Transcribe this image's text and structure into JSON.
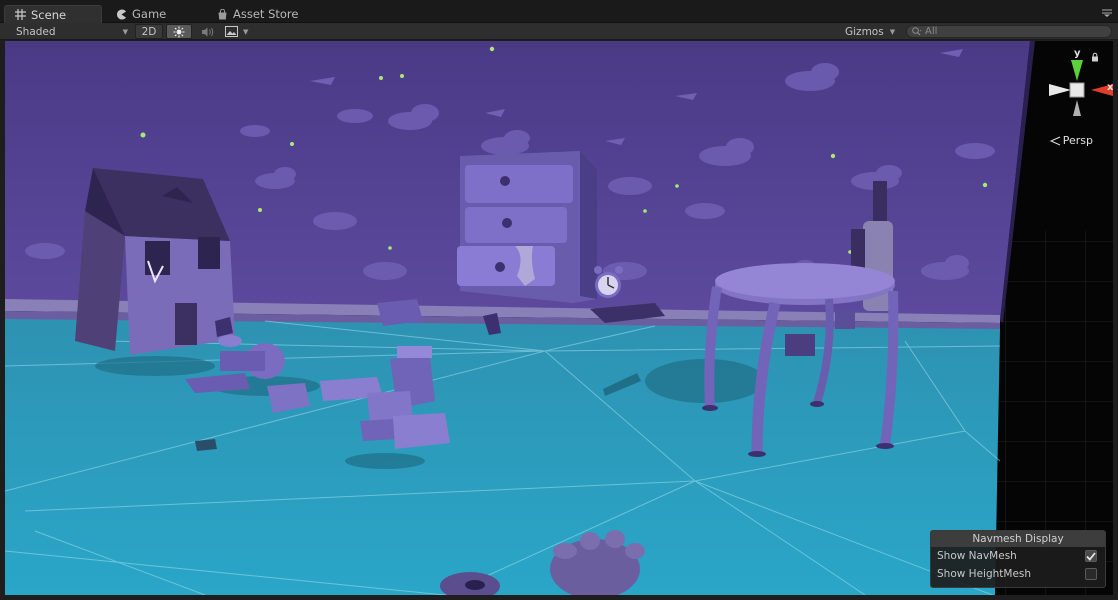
{
  "tabs": [
    {
      "label": "Scene",
      "icon": "scene-grid-icon",
      "active": true
    },
    {
      "label": "Game",
      "icon": "game-pacman-icon",
      "active": false
    },
    {
      "label": "Asset Store",
      "icon": "store-bag-icon",
      "active": false
    }
  ],
  "toolbar": {
    "shading_mode": "Shaded",
    "mode_2d_label": "2D",
    "gizmos_label": "Gizmos",
    "search_placeholder": "All"
  },
  "gizmo": {
    "axis_y": "y",
    "axis_x": "x",
    "projection_label": "Persp"
  },
  "navmesh_panel": {
    "title": "Navmesh Display",
    "options": [
      {
        "label": "Show NavMesh",
        "checked": true
      },
      {
        "label": "Show HeightMesh",
        "checked": false
      }
    ]
  },
  "colors": {
    "floor": "#2aa0c0",
    "wall": "#5a469a",
    "toys": "#7e6fc8",
    "gizmo_y": "#5ccf3a",
    "gizmo_x": "#e0402a"
  }
}
